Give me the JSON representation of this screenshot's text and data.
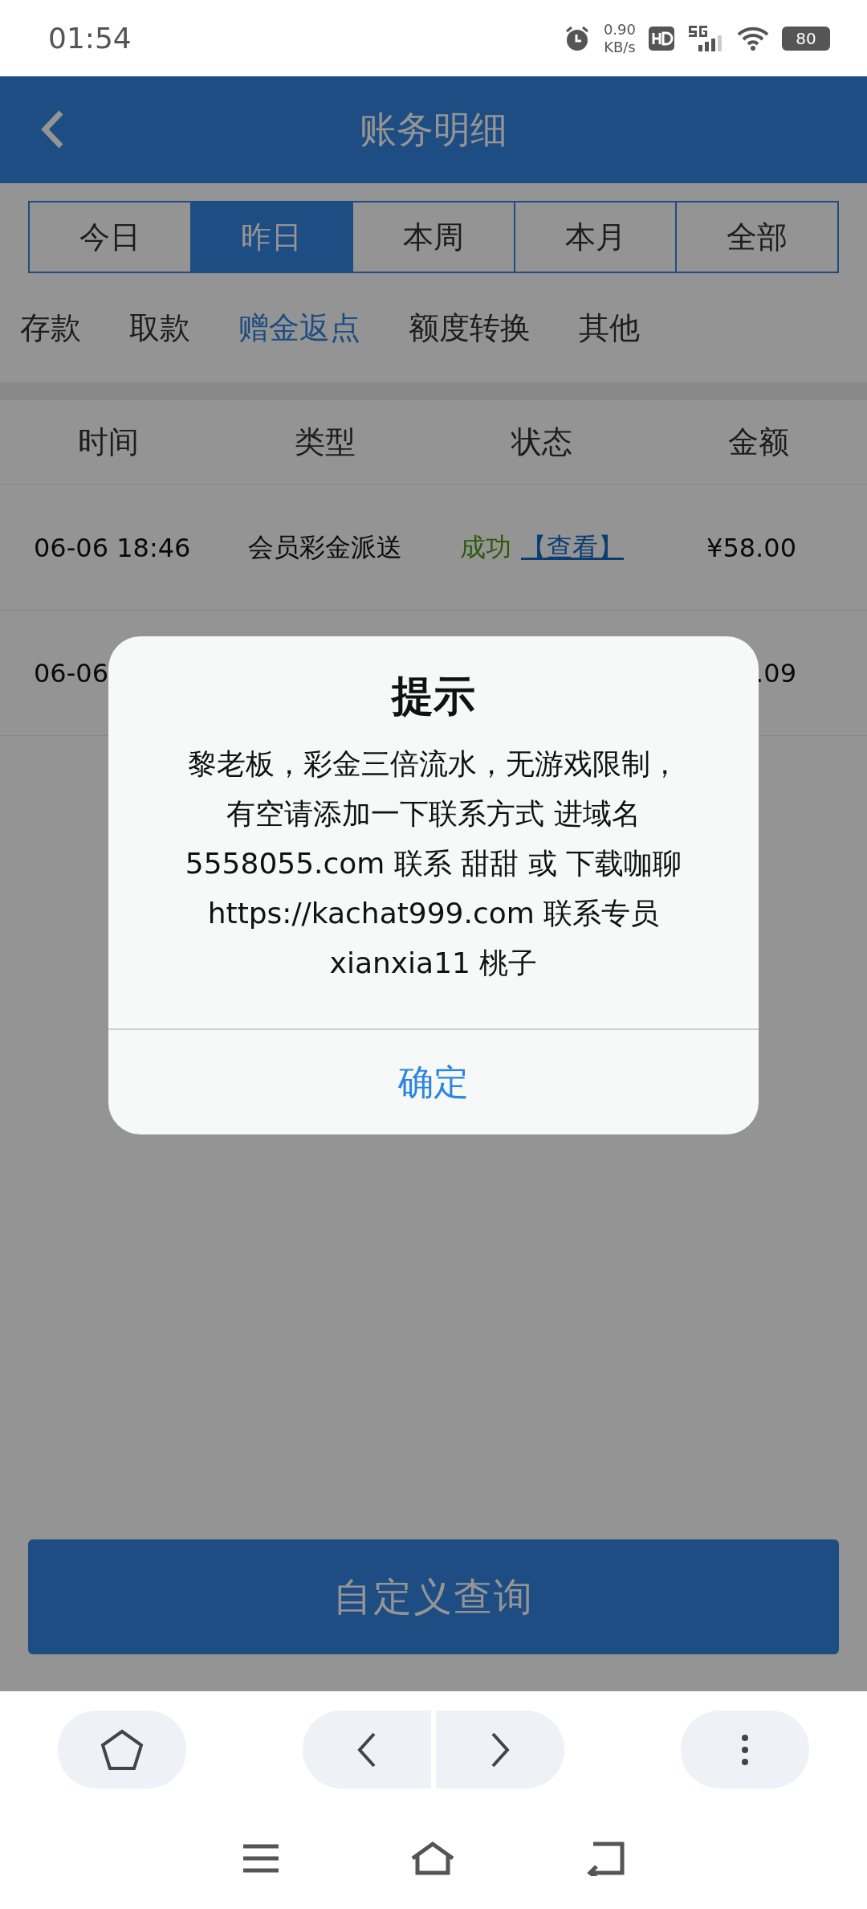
{
  "status_bar": {
    "time": "01:54",
    "speed_value": "0.90",
    "speed_unit": "KB/s",
    "battery": "80"
  },
  "header": {
    "title": "账务明细"
  },
  "period_tabs": [
    {
      "label": "今日",
      "selected": false
    },
    {
      "label": "昨日",
      "selected": true
    },
    {
      "label": "本周",
      "selected": false
    },
    {
      "label": "本月",
      "selected": false
    },
    {
      "label": "全部",
      "selected": false
    }
  ],
  "category_tabs": [
    {
      "label": "存款",
      "selected": false
    },
    {
      "label": "取款",
      "selected": false
    },
    {
      "label": "赠金返点",
      "selected": true
    },
    {
      "label": "额度转换",
      "selected": false
    },
    {
      "label": "其他",
      "selected": false
    }
  ],
  "table": {
    "columns": [
      "时间",
      "类型",
      "状态",
      "金额"
    ],
    "rows": [
      {
        "time": "06-06 18:46",
        "type": "会员彩金派送",
        "status": "成功",
        "link": "【查看】",
        "amount": "¥58.00"
      },
      {
        "time": "06-06",
        "amount": ".09"
      }
    ]
  },
  "custom_query_button": "自定义查询",
  "dialog": {
    "title": "提示",
    "message_lines": [
      "黎老板，彩金三倍流水，无游戏限制，",
      "有空请添加一下联系方式 进域名",
      "5558055.com 联系 甜甜 或 下载咖聊",
      "https://kachat999.com 联系专员",
      "xianxia11 桃子"
    ],
    "button": "确定"
  }
}
